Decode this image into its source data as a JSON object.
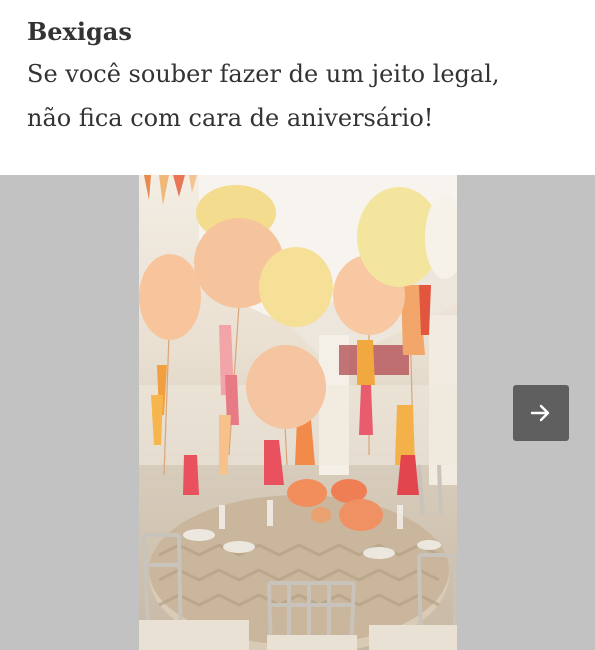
{
  "post": {
    "heading": "Bexigas",
    "caption_line1": "Se você souber fazer de um jeito legal,",
    "caption_line2": "não fica com cara de aniversário!"
  },
  "gallery": {
    "next_icon": "arrow-right-icon",
    "background_color": "#c2c2c2",
    "button_color": "#5f5f5f"
  }
}
